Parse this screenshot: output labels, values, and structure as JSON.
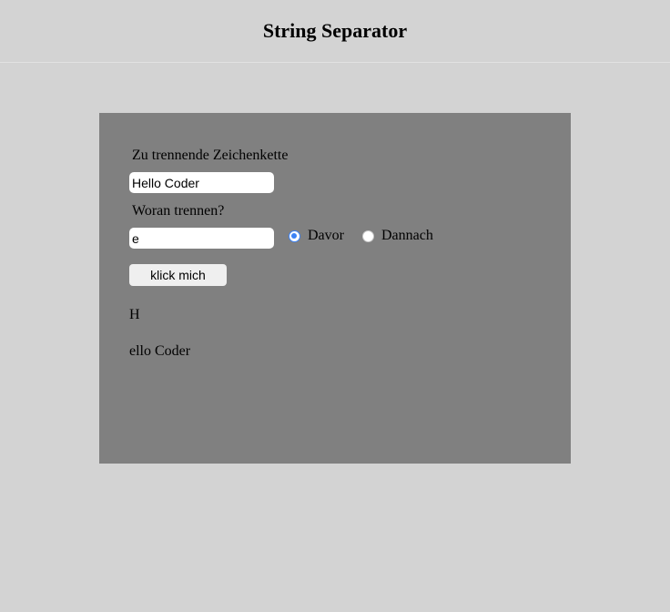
{
  "header": {
    "title": "String Separator"
  },
  "form": {
    "string_label": "Zu trennende Zeichenkette",
    "string_value": "Hello Coder",
    "separator_label": "Woran trennen?",
    "separator_value": "e",
    "radio_options": [
      {
        "label": "Davor",
        "checked": true
      },
      {
        "label": "Dannach",
        "checked": false
      }
    ],
    "button_label": "klick mich"
  },
  "results": {
    "first": "H",
    "second": "ello Coder"
  },
  "colors": {
    "page_background": "#d3d3d3",
    "panel_background": "#808080",
    "radio_accent": "#3b82f6"
  }
}
